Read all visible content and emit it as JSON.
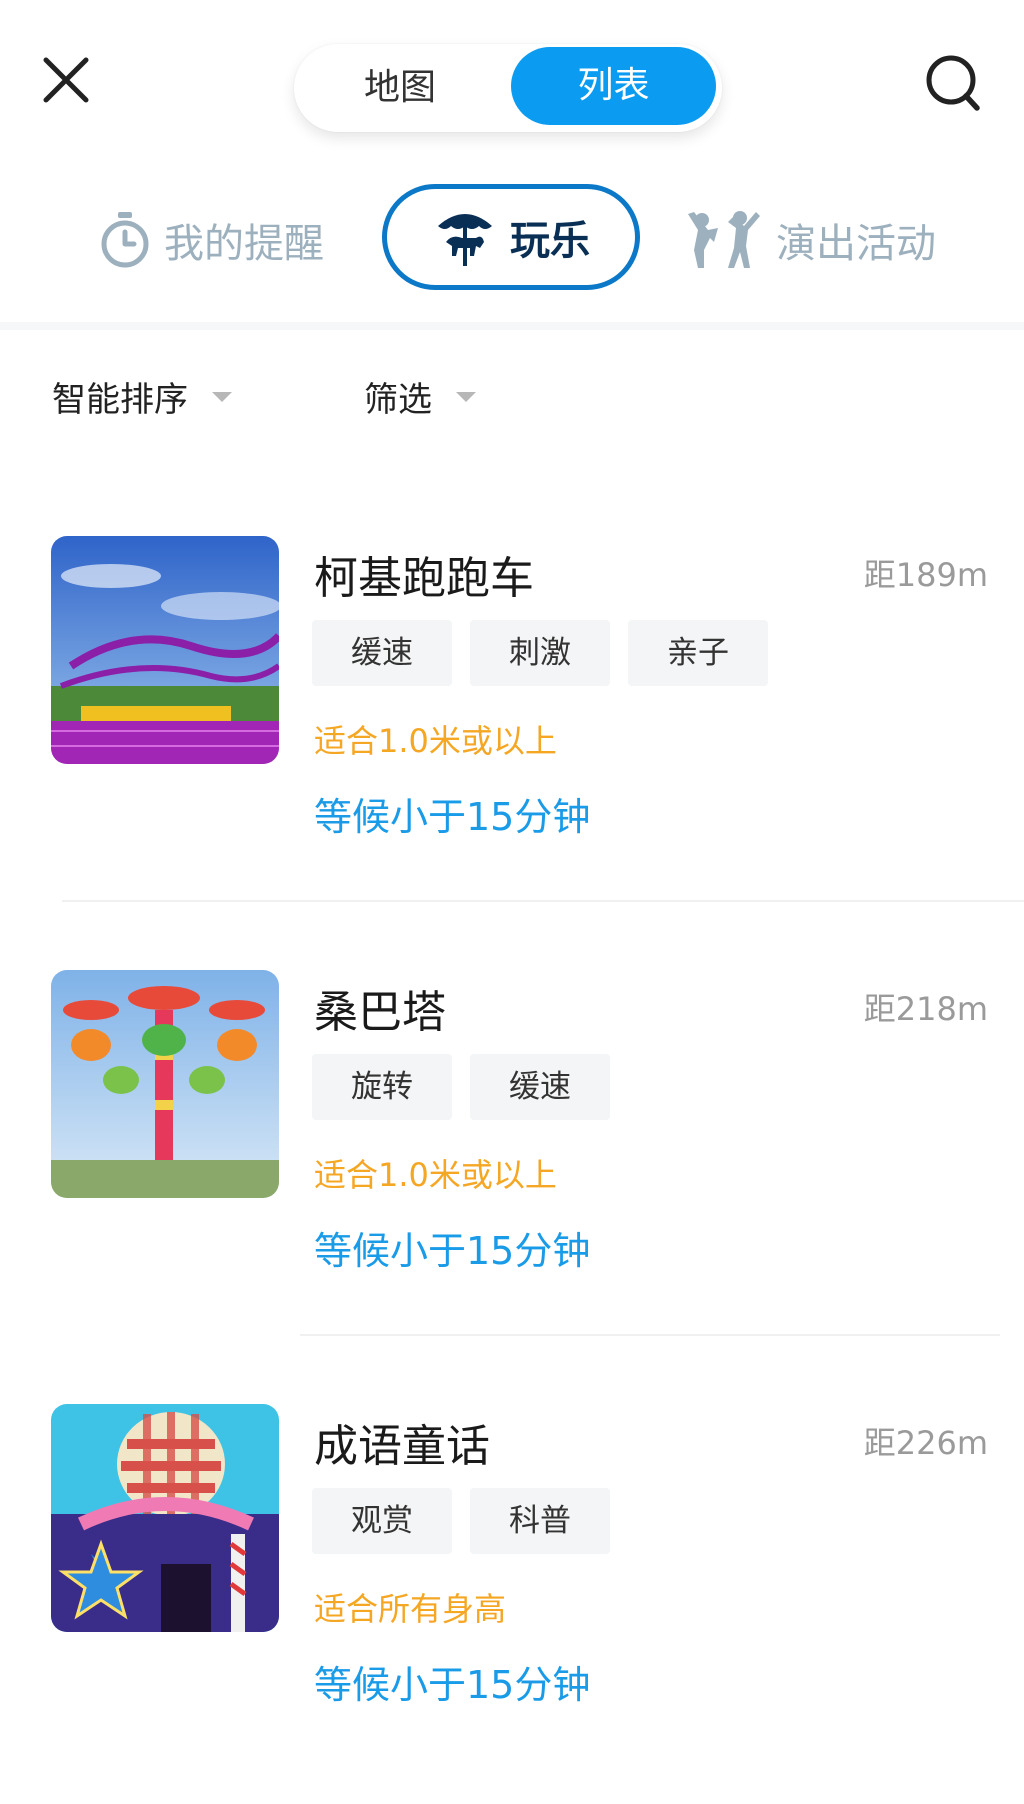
{
  "header": {
    "segments": [
      {
        "label": "地图",
        "active": false
      },
      {
        "label": "列表",
        "active": true
      }
    ]
  },
  "categories": [
    {
      "label": "我的提醒",
      "icon": "stopwatch-icon",
      "active": false
    },
    {
      "label": "玩乐",
      "icon": "carousel-icon",
      "active": true
    },
    {
      "label": "演出活动",
      "icon": "performers-icon",
      "active": false
    }
  ],
  "filters": {
    "sort_label": "智能排序",
    "filter_label": "筛选"
  },
  "colors": {
    "accent": "#0b9cf1",
    "height_text": "#f5a623",
    "wait_text": "#1a9be8",
    "active_tab_border": "#0b78c8"
  },
  "attractions": [
    {
      "name": "柯基跑跑车",
      "distance": "距189m",
      "tags": [
        "缓速",
        "刺激",
        "亲子"
      ],
      "height_req": "适合1.0米或以上",
      "wait": "等候小于15分钟",
      "image": "roller-coaster-photo"
    },
    {
      "name": "桑巴塔",
      "distance": "距218m",
      "tags": [
        "旋转",
        "缓速"
      ],
      "height_req": "适合1.0米或以上",
      "wait": "等候小于15分钟",
      "image": "drop-tower-photo"
    },
    {
      "name": "成语童话",
      "distance": "距226m",
      "tags": [
        "观赏",
        "科普"
      ],
      "height_req": "适合所有身高",
      "wait": "等候小于15分钟",
      "image": "fairytale-hall-photo"
    }
  ]
}
